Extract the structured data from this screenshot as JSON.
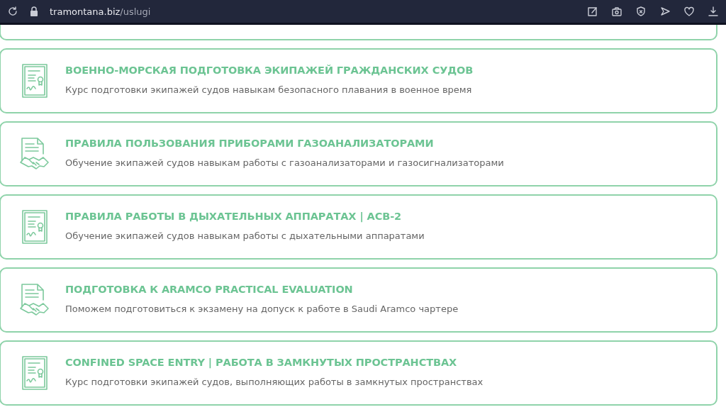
{
  "browser": {
    "url_domain": "tramontana.biz",
    "url_path": "/uslugi"
  },
  "services": [
    {
      "kind": "certificate",
      "title": "ВОЕННО-МОРСКАЯ ПОДГОТОВКА ЭКИПАЖЕЙ ГРАЖДАНСКИХ СУДОВ",
      "description": "Курс подготовки экипажей судов навыкам безопасного плавания в военное время"
    },
    {
      "kind": "agreement",
      "title": "ПРАВИЛА ПОЛЬЗОВАНИЯ ПРИБОРАМИ ГАЗОАНАЛИЗАТОРАМИ",
      "description": "Обучение экипажей судов навыкам работы с газоанализаторами и газосигнализаторами"
    },
    {
      "kind": "certificate",
      "title": "ПРАВИЛА РАБОТЫ В ДЫХАТЕЛЬНЫХ АППАРАТАХ | АСВ-2",
      "description": "Обучение экипажей судов навыкам работы с дыхательными аппаратами"
    },
    {
      "kind": "agreement",
      "title": "ПОДГОТОВКА К ARAMCO PRACTICAL EVALUATION",
      "description": "Поможем подготовиться к экзамену на допуск к работе в Saudi Aramco чартере"
    },
    {
      "kind": "certificate",
      "title": "CONFINED SPACE ENTRY | РАБОТА В ЗАМКНУТЫХ ПРОСТРАНСТВАХ",
      "description": "Курс подготовки экипажей судов, выполняющих работы в замкнутых пространствах"
    }
  ]
}
